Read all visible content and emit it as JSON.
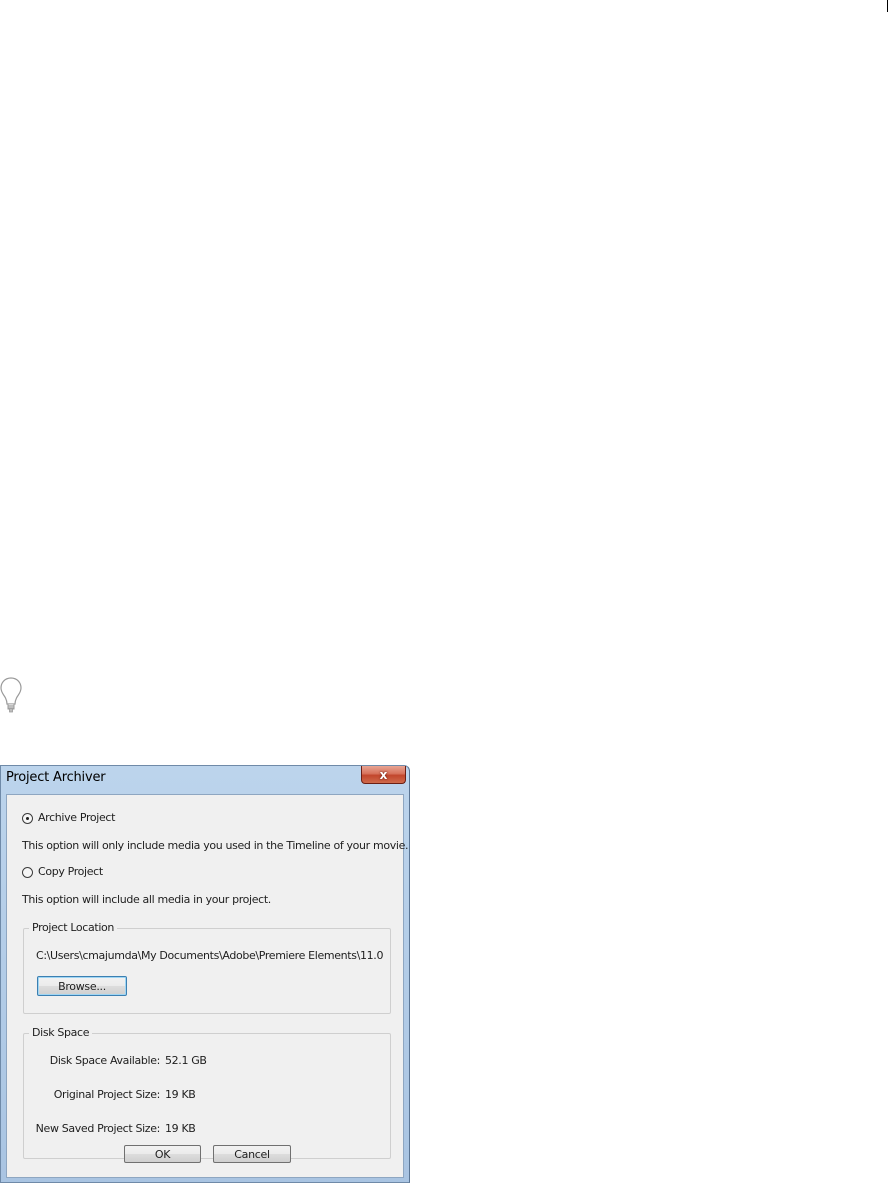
{
  "window": {
    "title": "Project Archiver",
    "close_glyph": "x"
  },
  "options": {
    "archive": {
      "label": "Archive Project",
      "selected": true,
      "description": "This option will only include media you used in the Timeline of your movie."
    },
    "copy": {
      "label": "Copy Project",
      "selected": false,
      "description": "This option will include all media in your project."
    }
  },
  "project_location": {
    "group_label": "Project Location",
    "path": "C:\\Users\\cmajumda\\My Documents\\Adobe\\Premiere Elements\\11.0",
    "browse_label": "Browse..."
  },
  "disk_space": {
    "group_label": "Disk Space",
    "rows": [
      {
        "label": "Disk Space Available:",
        "value": "52.1 GB"
      },
      {
        "label": "Original Project Size:",
        "value": "19 KB"
      },
      {
        "label": "New Saved Project Size:",
        "value": "19 KB"
      }
    ]
  },
  "buttons": {
    "ok_label": "OK",
    "cancel_label": "Cancel"
  },
  "icons": {
    "tip": "lightbulb-icon",
    "close": "close-icon"
  },
  "colors": {
    "titlebar": "#bcd4ec",
    "client_bg": "#f0f0f0",
    "close_button": "#c2462c",
    "focus_border": "#3c7fb1"
  }
}
